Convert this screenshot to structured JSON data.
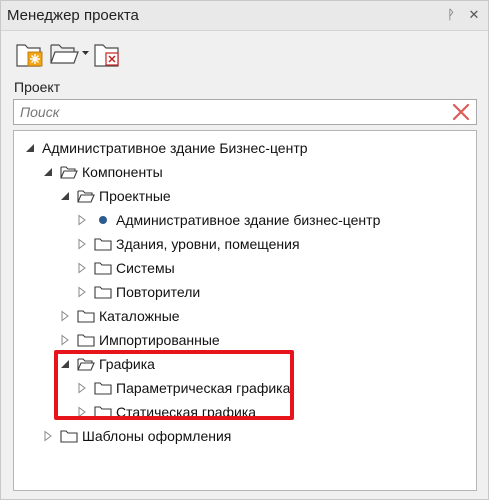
{
  "window": {
    "title": "Менеджер проекта",
    "pin_glyph": "ᚹ",
    "close_glyph": "✕"
  },
  "toolbar": {
    "buttons": [
      {
        "name": "new-project-button",
        "icon": "new-folder-icon"
      },
      {
        "name": "open-project-button",
        "icon": "open-folder-icon"
      },
      {
        "name": "close-project-button",
        "icon": "close-folder-icon"
      }
    ]
  },
  "section_label": "Проект",
  "search": {
    "placeholder": "Поиск",
    "value": ""
  },
  "tree": {
    "items": [
      {
        "label": "Административное здание Бизнес-центр",
        "level": 0,
        "expander": "expanded",
        "icon": "none"
      },
      {
        "label": "Компоненты",
        "level": 1,
        "expander": "expanded",
        "icon": "open-folder"
      },
      {
        "label": "Проектные",
        "level": 2,
        "expander": "expanded",
        "icon": "open-folder"
      },
      {
        "label": "Административное здание бизнес-центр",
        "level": 3,
        "expander": "collapsed",
        "icon": "dot"
      },
      {
        "label": "Здания, уровни, помещения",
        "level": 3,
        "expander": "collapsed",
        "icon": "folder"
      },
      {
        "label": "Системы",
        "level": 3,
        "expander": "collapsed",
        "icon": "folder"
      },
      {
        "label": "Повторители",
        "level": 3,
        "expander": "collapsed",
        "icon": "folder"
      },
      {
        "label": "Каталожные",
        "level": 2,
        "expander": "collapsed",
        "icon": "folder"
      },
      {
        "label": "Импортированные",
        "level": 2,
        "expander": "collapsed",
        "icon": "folder"
      },
      {
        "label": "Графика",
        "level": 2,
        "expander": "expanded",
        "icon": "open-folder"
      },
      {
        "label": "Параметрическая графика",
        "level": 3,
        "expander": "collapsed",
        "icon": "folder"
      },
      {
        "label": "Статическая графика",
        "level": 3,
        "expander": "collapsed",
        "icon": "folder"
      },
      {
        "label": "Шаблоны оформления",
        "level": 1,
        "expander": "collapsed",
        "icon": "folder"
      }
    ]
  },
  "colors": {
    "highlight": "#e8141b",
    "accent_new": "#f2a515",
    "accent_close": "#c42222"
  }
}
